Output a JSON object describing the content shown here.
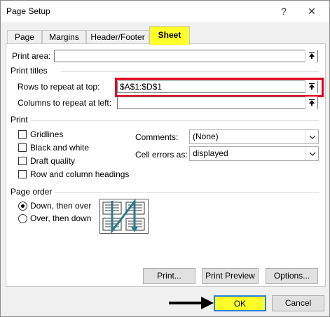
{
  "window": {
    "title": "Page Setup",
    "help": "?",
    "close": "✕"
  },
  "tabs": [
    "Page",
    "Margins",
    "Header/Footer",
    "Sheet"
  ],
  "print_area": {
    "label": "Print area:",
    "value": ""
  },
  "print_titles": {
    "heading": "Print titles",
    "rows_label": "Rows to repeat at top:",
    "rows_value": "$A$1:$D$1",
    "cols_label": "Columns to repeat at left:",
    "cols_value": ""
  },
  "print": {
    "heading": "Print",
    "gridlines": "Gridlines",
    "black_white": "Black and white",
    "draft": "Draft quality",
    "headings": "Row and column headings",
    "comments_label": "Comments:",
    "comments_value": "(None)",
    "errors_label": "Cell errors as:",
    "errors_value": "displayed"
  },
  "page_order": {
    "heading": "Page order",
    "down_over": "Down, then over",
    "over_down": "Over, then down",
    "selected": "Down, then over"
  },
  "buttons": {
    "print": "Print...",
    "preview": "Print Preview",
    "options": "Options...",
    "ok": "OK",
    "cancel": "Cancel"
  },
  "colors": {
    "highlight": "#ffff29",
    "red_outline": "#e0001b",
    "tab_border": "#c8c8c8"
  }
}
